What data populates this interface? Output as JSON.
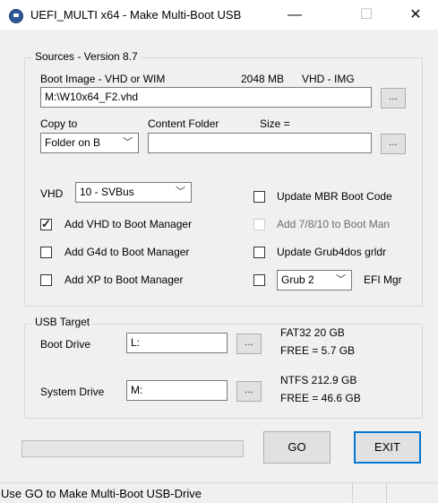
{
  "window": {
    "title": "UEFI_MULTI x64 - Make Multi-Boot USB",
    "minimize": "—",
    "maximize": "☐",
    "close": "✕"
  },
  "sources": {
    "legend": "Sources   - Version 8.7",
    "boot_image_label": "Boot Image - VHD or WIM",
    "size_info": "2048 MB",
    "type_info": "VHD - IMG",
    "boot_image_value": "M:\\W10x64_F2.vhd",
    "browse": "...",
    "copy_to_label": "Copy to",
    "content_folder_label": "Content Folder",
    "size_label": "Size  =",
    "copy_to_value": "Folder on B",
    "content_folder_value": "",
    "vhd_label": "VHD",
    "vhd_value": "10 - SVBus",
    "checks": {
      "update_mbr": "Update MBR Boot Code",
      "add_vhd": "Add VHD to Boot Manager",
      "add_7810": "Add 7/8/10 to Boot Man",
      "add_g4d": "Add G4d to Boot Manager",
      "update_grub4dos": "Update Grub4dos grldr",
      "add_xp": "Add XP  to Boot Manager",
      "efi_mgr": "EFI Mgr"
    },
    "grub_value": "Grub 2"
  },
  "usb": {
    "legend": "USB Target",
    "boot_drive_label": "Boot Drive",
    "boot_drive_value": "L:",
    "boot_fs": "FAT32    20 GB",
    "boot_free": "FREE  = 5.7 GB",
    "system_drive_label": "System Drive",
    "system_drive_value": "M:",
    "system_fs": "NTFS    212.9 GB",
    "system_free": "FREE  = 46.6 GB"
  },
  "actions": {
    "go": "GO",
    "exit": "EXIT",
    "progress": 0
  },
  "status": {
    "text": "Use GO to Make Multi-Boot USB-Drive"
  }
}
